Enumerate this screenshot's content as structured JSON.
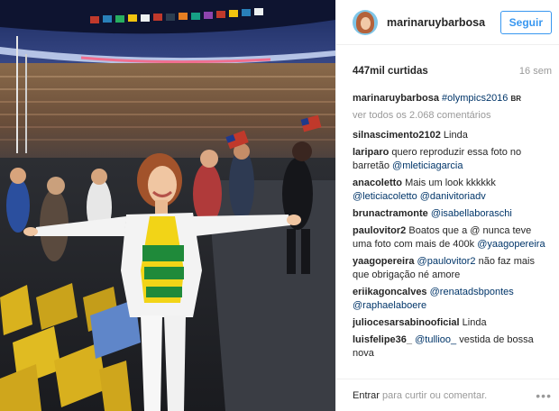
{
  "profile": {
    "username": "marinaruybarbosa",
    "follow_label": "Seguir"
  },
  "stats": {
    "likes": "447mil curtidas",
    "age": "16 sem"
  },
  "caption": {
    "username": "marinaruybarbosa",
    "text": "#olympics2016",
    "flag": "BR"
  },
  "view_all": "ver todos os 2.068 comentários",
  "comments": [
    {
      "user": "silnascimento2102",
      "parts": [
        {
          "t": "Linda",
          "tag": false
        }
      ]
    },
    {
      "user": "lariparo",
      "parts": [
        {
          "t": "quero reproduzir essa foto no barretão ",
          "tag": false
        },
        {
          "t": "@mleticiagarcia",
          "tag": true
        }
      ]
    },
    {
      "user": "anacoletto",
      "parts": [
        {
          "t": "Mais um look kkkkkk ",
          "tag": false
        },
        {
          "t": "@leticiacoletto",
          "tag": true
        },
        {
          "t": " ",
          "tag": false
        },
        {
          "t": "@danivitoriadv",
          "tag": true
        }
      ]
    },
    {
      "user": "brunactramonte",
      "parts": [
        {
          "t": "@isabellaboraschi",
          "tag": true
        }
      ]
    },
    {
      "user": "paulovitor2",
      "parts": [
        {
          "t": "Boatos que a @ nunca teve uma foto com mais de 400k ",
          "tag": false
        },
        {
          "t": "@yaagopereira",
          "tag": true
        }
      ]
    },
    {
      "user": "yaagopereira",
      "parts": [
        {
          "t": "@paulovitor2",
          "tag": true
        },
        {
          "t": " não faz mais que obrigação né amore",
          "tag": false
        }
      ]
    },
    {
      "user": "eriikagoncalves",
      "parts": [
        {
          "t": "@renatadsbpontes",
          "tag": true
        },
        {
          "t": " ",
          "tag": false
        },
        {
          "t": "@raphaelaboere",
          "tag": true
        }
      ]
    },
    {
      "user": "juliocesarsabinooficial",
      "parts": [
        {
          "t": "Linda",
          "tag": false
        }
      ]
    },
    {
      "user": "luisfelipe36_",
      "parts": [
        {
          "t": "@tullioo_",
          "tag": true
        },
        {
          "t": " vestida de bossa nova",
          "tag": false
        }
      ]
    }
  ],
  "footer": {
    "login_link": "Entrar",
    "prompt": " para curtir ou comentar.",
    "more_icon": "more-dots-icon"
  },
  "colors": {
    "accent": "#3897f0",
    "tag": "#003569",
    "muted": "#999999",
    "shirt_yellow": "#f2d417",
    "shirt_green": "#1f8a3a",
    "jacket": "#f4f4f4"
  }
}
